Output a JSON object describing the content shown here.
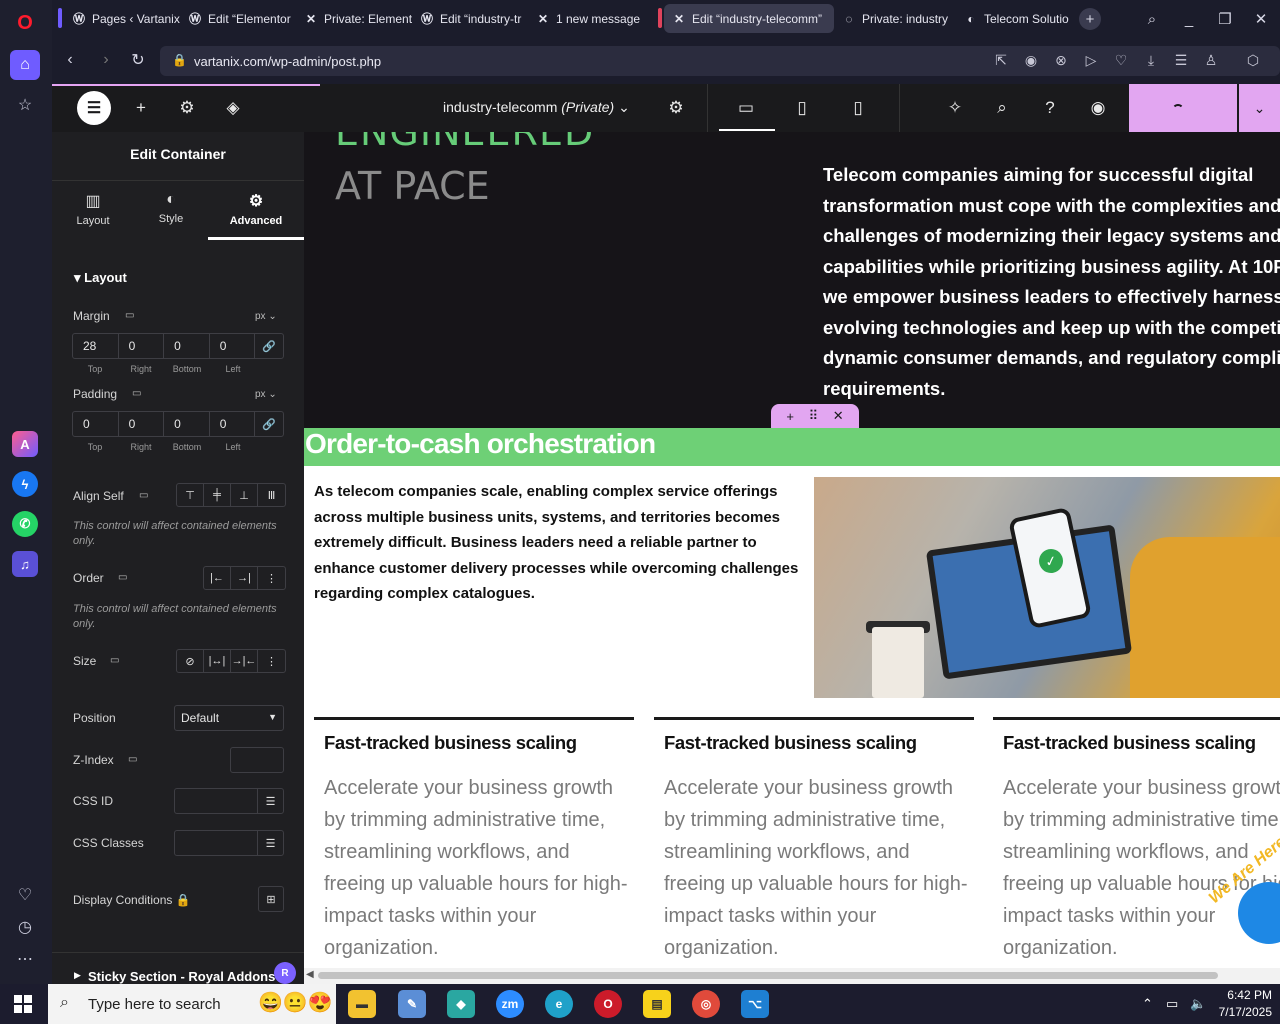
{
  "browser": {
    "tabs": [
      {
        "label": "Pages ‹ Vartanix",
        "icon": "wordpress-icon"
      },
      {
        "label": "Edit “Elementor",
        "icon": "wordpress-icon"
      },
      {
        "label": "Private: Element",
        "icon": "elementor-x-icon"
      },
      {
        "label": "Edit “industry-tr",
        "icon": "wordpress-icon"
      },
      {
        "label": "1 new message",
        "icon": "elementor-x-icon"
      },
      {
        "label": "Edit “industry-telecomm”",
        "icon": "elementor-x-icon"
      },
      {
        "label": "Private: industry",
        "icon": "loading-icon"
      },
      {
        "label": "Telecom Solutio",
        "icon": "site-favicon"
      }
    ],
    "url": "vartanix.com/wp-admin/post.php",
    "accent_colors": {
      "tab_group_1": "#6f5cff",
      "tab_group_2": "#e0435c"
    }
  },
  "elementor": {
    "page_name": "industry-telecomm",
    "page_status": "(Private)",
    "panel": {
      "title": "Edit Container",
      "tabs": [
        "Layout",
        "Style",
        "Advanced"
      ],
      "active_tab": "Advanced",
      "section": "Layout",
      "margin": {
        "label": "Margin",
        "unit": "px",
        "top": "28",
        "right": "0",
        "bottom": "0",
        "left": "0"
      },
      "padding": {
        "label": "Padding",
        "unit": "px",
        "top": "0",
        "right": "0",
        "bottom": "0",
        "left": "0"
      },
      "dim_labels": [
        "Top",
        "Right",
        "Bottom",
        "Left"
      ],
      "align_self": "Align Self",
      "note": "This control will affect contained elements only.",
      "order": "Order",
      "size": "Size",
      "position": {
        "label": "Position",
        "value": "Default"
      },
      "z_index": "Z-Index",
      "css_id": "CSS ID",
      "css_classes": "CSS Classes",
      "display_conditions": "Display Conditions",
      "sticky_section": "Sticky Section - Royal Addons",
      "badge": "R"
    },
    "accent": "#e2a6f1"
  },
  "canvas": {
    "hero_heading_1": "ENGINEERED",
    "hero_heading_2": "AT PACE",
    "hero_paragraph": "Telecom companies aiming for successful digital\ntransformation must cope with the complexities and\nchallenges of modernizing their legacy systems and\ncapabilities while prioritizing business agility. At 10Pearls,\nwe empower business leaders to effectively harness\nevolving technologies and keep up with the competitive\ndynamic consumer demands, and regulatory compliance\nrequirements.",
    "otc_title": "Order-to-cash orchestration",
    "otc_paragraph": "As telecom companies scale, enabling complex service offerings across multiple business units, systems, and territories becomes extremely difficult. Business leaders need a reliable partner to enhance customer delivery processes while overcoming challenges regarding complex catalogues.",
    "features": [
      {
        "title": "Fast-tracked business scaling",
        "text": "Accelerate your business growth by trimming administrative time, streamlining workflows, and freeing up valuable hours for high-impact tasks within your organization."
      },
      {
        "title": "Fast-tracked business scaling",
        "text": "Accelerate your business growth by trimming administrative time, streamlining workflows, and freeing up valuable hours for high-impact tasks within your organization."
      },
      {
        "title": "Fast-tracked business scaling",
        "text": "Accelerate your business growth by trimming administrative time, streamlining workflows, and freeing up valuable hours for high-impact tasks within your organization."
      }
    ],
    "green": "#6ed076",
    "chat_badge_text": "We Are Here!"
  },
  "taskbar": {
    "search_placeholder": "Type here to search",
    "time": "6:42 PM",
    "date": "7/17/2025"
  }
}
